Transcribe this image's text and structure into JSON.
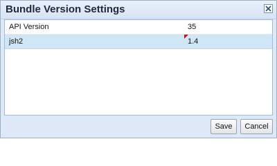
{
  "dialog": {
    "title": "Bundle Version Settings",
    "close_icon": "close-x-icon"
  },
  "grid": {
    "rows": [
      {
        "name": "API Version",
        "value": "35",
        "selected": false,
        "modified": false
      },
      {
        "name": "jsh2",
        "value": "1.4",
        "selected": true,
        "modified": true
      }
    ]
  },
  "footer": {
    "save_label": "Save",
    "cancel_label": "Cancel"
  },
  "colors": {
    "dialog_bg": "#dfe8f6",
    "selected_row": "#d0e6f4",
    "modified_marker": "#cc1111",
    "grid_border": "#99bbe8"
  }
}
